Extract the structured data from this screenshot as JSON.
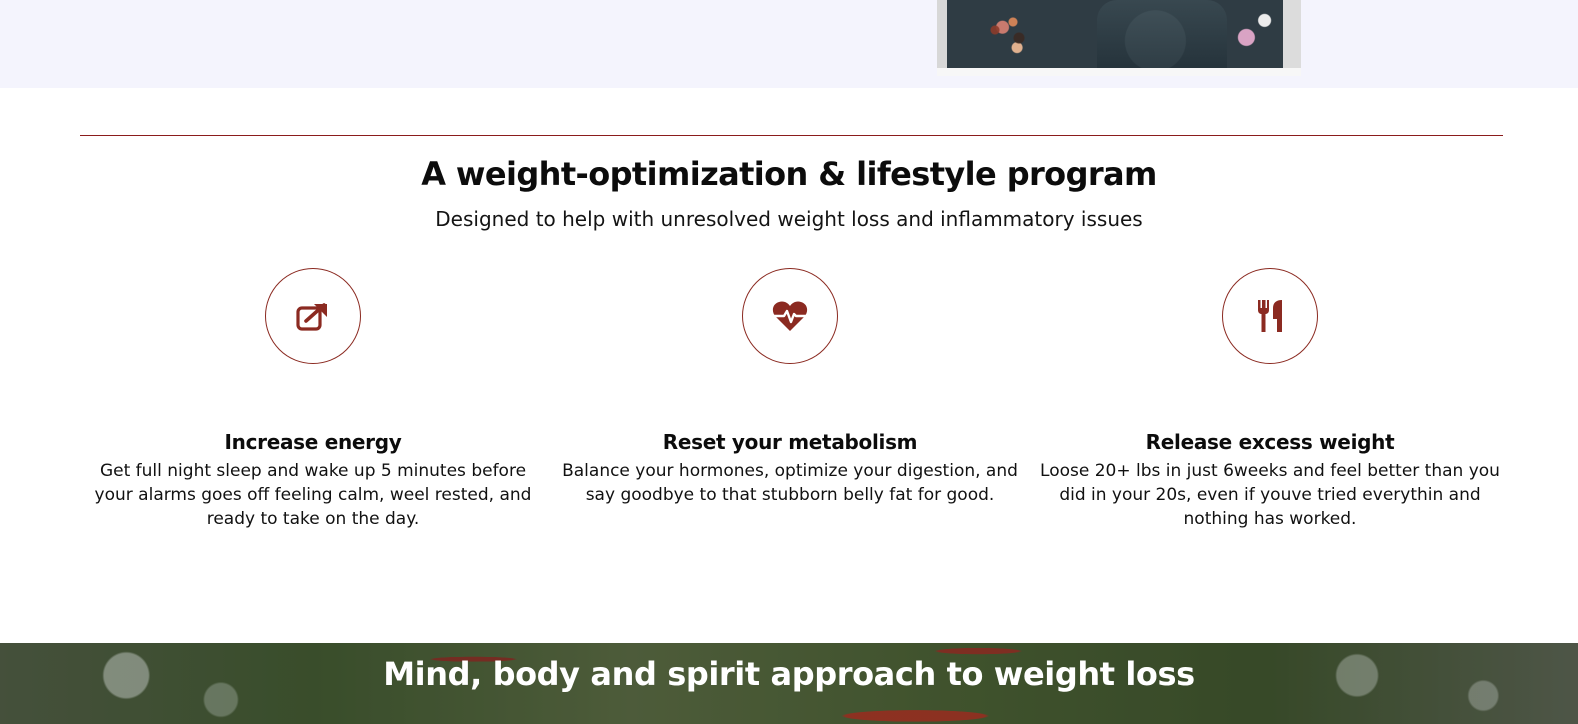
{
  "section": {
    "title": "A weight-optimization & lifestyle program",
    "subtitle": "Designed to help with unresolved weight loss and inflammatory issues"
  },
  "features": [
    {
      "icon": "external-link-icon",
      "title": "Increase energy",
      "text": "Get full night sleep and wake up 5 minutes before your alarms goes off feeling calm, weel rested, and ready to take on the day."
    },
    {
      "icon": "heartbeat-icon",
      "title": "Reset your metabolism",
      "text": "Balance your hormones, optimize your digestion, and say goodbye to that stubborn belly fat for good."
    },
    {
      "icon": "utensils-icon",
      "title": "Release excess weight",
      "text": "Loose 20+ lbs in just 6weeks and feel better than you did in your 20s, even if youve tried everythin and nothing has worked."
    }
  ],
  "banner": {
    "title": "Mind, body and spirit approach to weight loss"
  },
  "colors": {
    "accent": "#8b2a21",
    "top_band": "#f4f4fd"
  }
}
